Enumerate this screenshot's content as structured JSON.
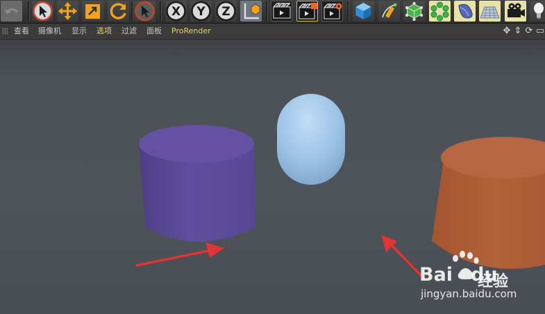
{
  "menu": {
    "items": [
      "查看",
      "摄像机",
      "显示",
      "选项",
      "过滤",
      "面板",
      "ProRender"
    ],
    "active_item": "选项"
  },
  "viewport": {
    "objects": [
      {
        "type": "cylinder",
        "color": "#5f4f9e"
      },
      {
        "type": "capsule",
        "color": "#9cc2e6"
      },
      {
        "type": "cylinder",
        "color": "#b2623a"
      }
    ],
    "annotation_arrow_color": "#e23434"
  },
  "watermark": {
    "logo_left": "Bai",
    "logo_right": "du",
    "label": "经验",
    "url": "jingyan.baidu.com"
  },
  "toolbar": {
    "axis_labels": [
      "X",
      "Y",
      "Z"
    ],
    "icons": [
      "undo-icon",
      "select-arrow-icon",
      "move-icon",
      "scale-icon",
      "rotate-icon",
      "live-select-icon",
      "x-axis-icon",
      "y-axis-icon",
      "z-axis-icon",
      "coordinate-system-icon",
      "render-view-icon",
      "render-to-picture-viewer-icon",
      "render-settings-icon",
      "cube-icon",
      "pen-icon",
      "subdivision-icon",
      "mograph-icon",
      "deformer-icon",
      "floor-icon",
      "camera-icon",
      "light-icon"
    ]
  },
  "colors": {
    "accent": "#e7d57a",
    "toolbar_bg": "#333333",
    "viewport_bg": "#4d5358"
  }
}
